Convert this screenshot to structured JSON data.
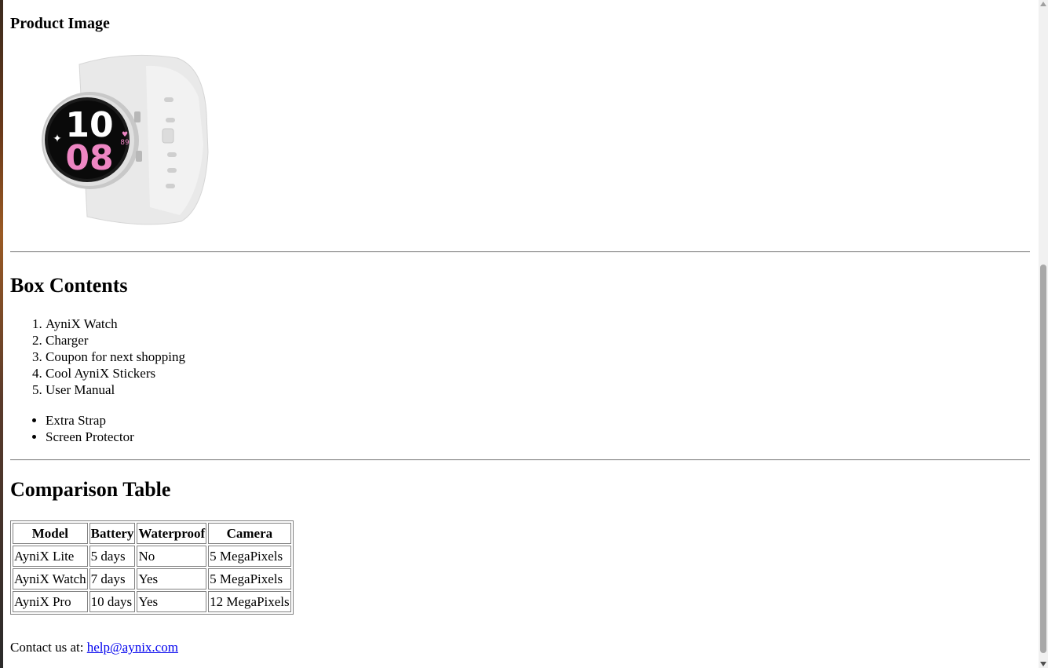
{
  "product": {
    "heading": "Product Image",
    "watch_face": {
      "hour": "10",
      "minute": "08",
      "heart_rate": "89"
    }
  },
  "box": {
    "heading": "Box Contents",
    "ordered_items": [
      "AyniX Watch",
      "Charger",
      "Coupon for next shopping",
      "Cool AyniX Stickers",
      "User Manual"
    ],
    "extra_items": [
      "Extra Strap",
      "Screen Protector"
    ]
  },
  "comparison": {
    "heading": "Comparison Table",
    "headers": [
      "Model",
      "Battery",
      "Waterproof",
      "Camera"
    ],
    "rows": [
      [
        "AyniX Lite",
        "5 days",
        "No",
        "5 MegaPixels"
      ],
      [
        "AyniX Watch",
        "7 days",
        "Yes",
        "5 MegaPixels"
      ],
      [
        "AyniX Pro",
        "10 days",
        "Yes",
        "12 MegaPixels"
      ]
    ]
  },
  "contact": {
    "prefix": "Contact us at: ",
    "email": "help@aynix.com"
  }
}
